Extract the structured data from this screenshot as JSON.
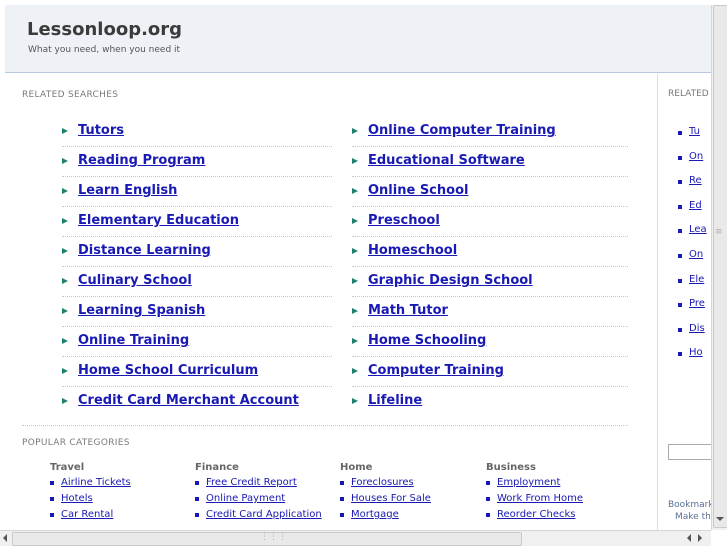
{
  "header": {
    "title": "Lessonloop.org",
    "tagline": "What you need, when you need it"
  },
  "related_title": "RELATED SEARCHES",
  "related_left": [
    "Tutors",
    "Reading Program",
    "Learn English",
    "Elementary Education",
    "Distance Learning",
    "Culinary School",
    "Learning Spanish",
    "Online Training",
    "Home School Curriculum",
    "Credit Card Merchant Account"
  ],
  "related_right": [
    "Online Computer Training",
    "Educational Software",
    "Online School",
    "Preschool",
    "Homeschool",
    "Graphic Design School",
    "Math Tutor",
    "Home Schooling",
    "Computer Training",
    "Lifeline"
  ],
  "popular_title": "POPULAR CATEGORIES",
  "categories": [
    {
      "title": "Travel",
      "items": [
        "Airline Tickets",
        "Hotels",
        "Car Rental"
      ]
    },
    {
      "title": "Finance",
      "items": [
        "Free Credit Report",
        "Online Payment",
        "Credit Card Application"
      ]
    },
    {
      "title": "Home",
      "items": [
        "Foreclosures",
        "Houses For Sale",
        "Mortgage"
      ]
    },
    {
      "title": "Business",
      "items": [
        "Employment",
        "Work From Home",
        "Reorder Checks"
      ]
    }
  ],
  "sidebar": {
    "title": "RELATED",
    "items": [
      "Tu",
      "On",
      "Re",
      "Ed",
      "Lea",
      "On",
      "Ele",
      "Pre",
      "Dis",
      "Ho"
    ],
    "bookmark": "Bookmark",
    "make_this": "Make thi"
  }
}
